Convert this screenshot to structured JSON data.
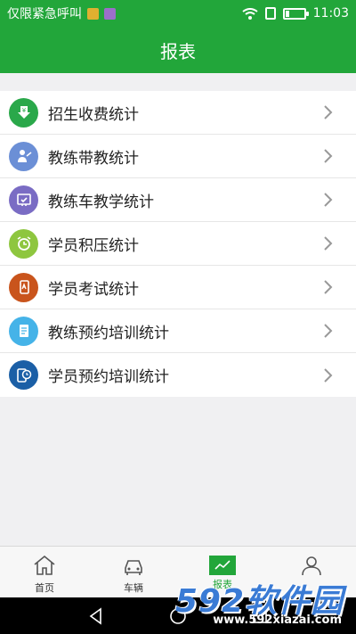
{
  "status": {
    "carrier_text": "仅限紧急呼叫",
    "time": "11:03"
  },
  "header": {
    "title": "报表"
  },
  "list": {
    "items": [
      {
        "label": "招生收费统计",
        "icon": "money-download-icon",
        "color": "#2aa84a"
      },
      {
        "label": "教练带教统计",
        "icon": "coach-teaching-icon",
        "color": "#6b8fd6"
      },
      {
        "label": "教练车教学统计",
        "icon": "car-check-icon",
        "color": "#7a6cc4"
      },
      {
        "label": "学员积压统计",
        "icon": "alarm-clock-icon",
        "color": "#8ec63f"
      },
      {
        "label": "学员考试统计",
        "icon": "exam-phone-icon",
        "color": "#c9541c"
      },
      {
        "label": "教练预约培训统计",
        "icon": "document-icon",
        "color": "#45b3e8"
      },
      {
        "label": "学员预约培训统计",
        "icon": "phone-clock-icon",
        "color": "#1b5fa6"
      }
    ]
  },
  "tabbar": {
    "tabs": [
      {
        "label": "首页",
        "icon": "home-icon"
      },
      {
        "label": "车辆",
        "icon": "car-icon"
      },
      {
        "label": "报表",
        "icon": "chart-icon",
        "active": true
      },
      {
        "label": "",
        "icon": "user-icon"
      }
    ]
  },
  "watermark": {
    "brand": "592软件园",
    "url": "www.592xiazai.com"
  },
  "colors": {
    "primary": "#22a63a"
  }
}
